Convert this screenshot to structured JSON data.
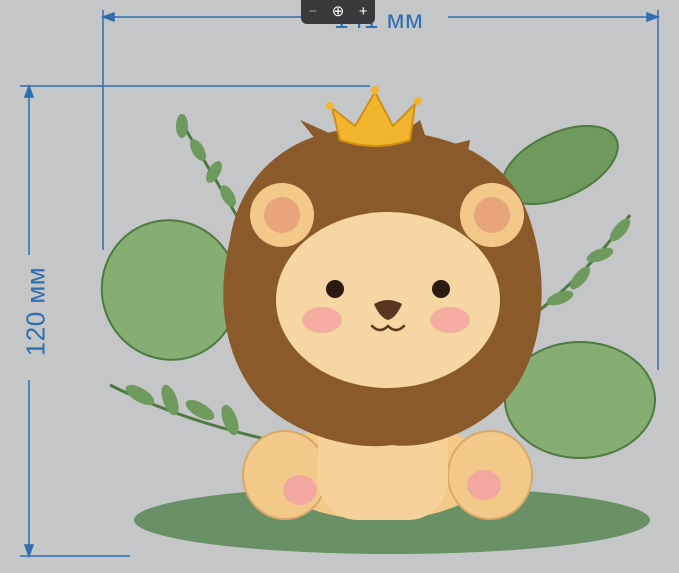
{
  "dimensions": {
    "width_label": "141 мм",
    "height_label": "120 мм"
  },
  "zoom_toolbar": {
    "zoom_out": "−",
    "zoom_icon": "⊕",
    "zoom_in": "+"
  },
  "colors": {
    "background": "#c5c6c8",
    "dimension_line": "#2f6fb0",
    "mane": "#8b5a2b",
    "face": "#f6d7a4",
    "leaf": "#6f9a5e",
    "ground": "#5f8a5b",
    "crown": "#f2b62e"
  },
  "icons": [
    "zoom-out-icon",
    "zoom-in-icon",
    "magnifier-icon"
  ]
}
